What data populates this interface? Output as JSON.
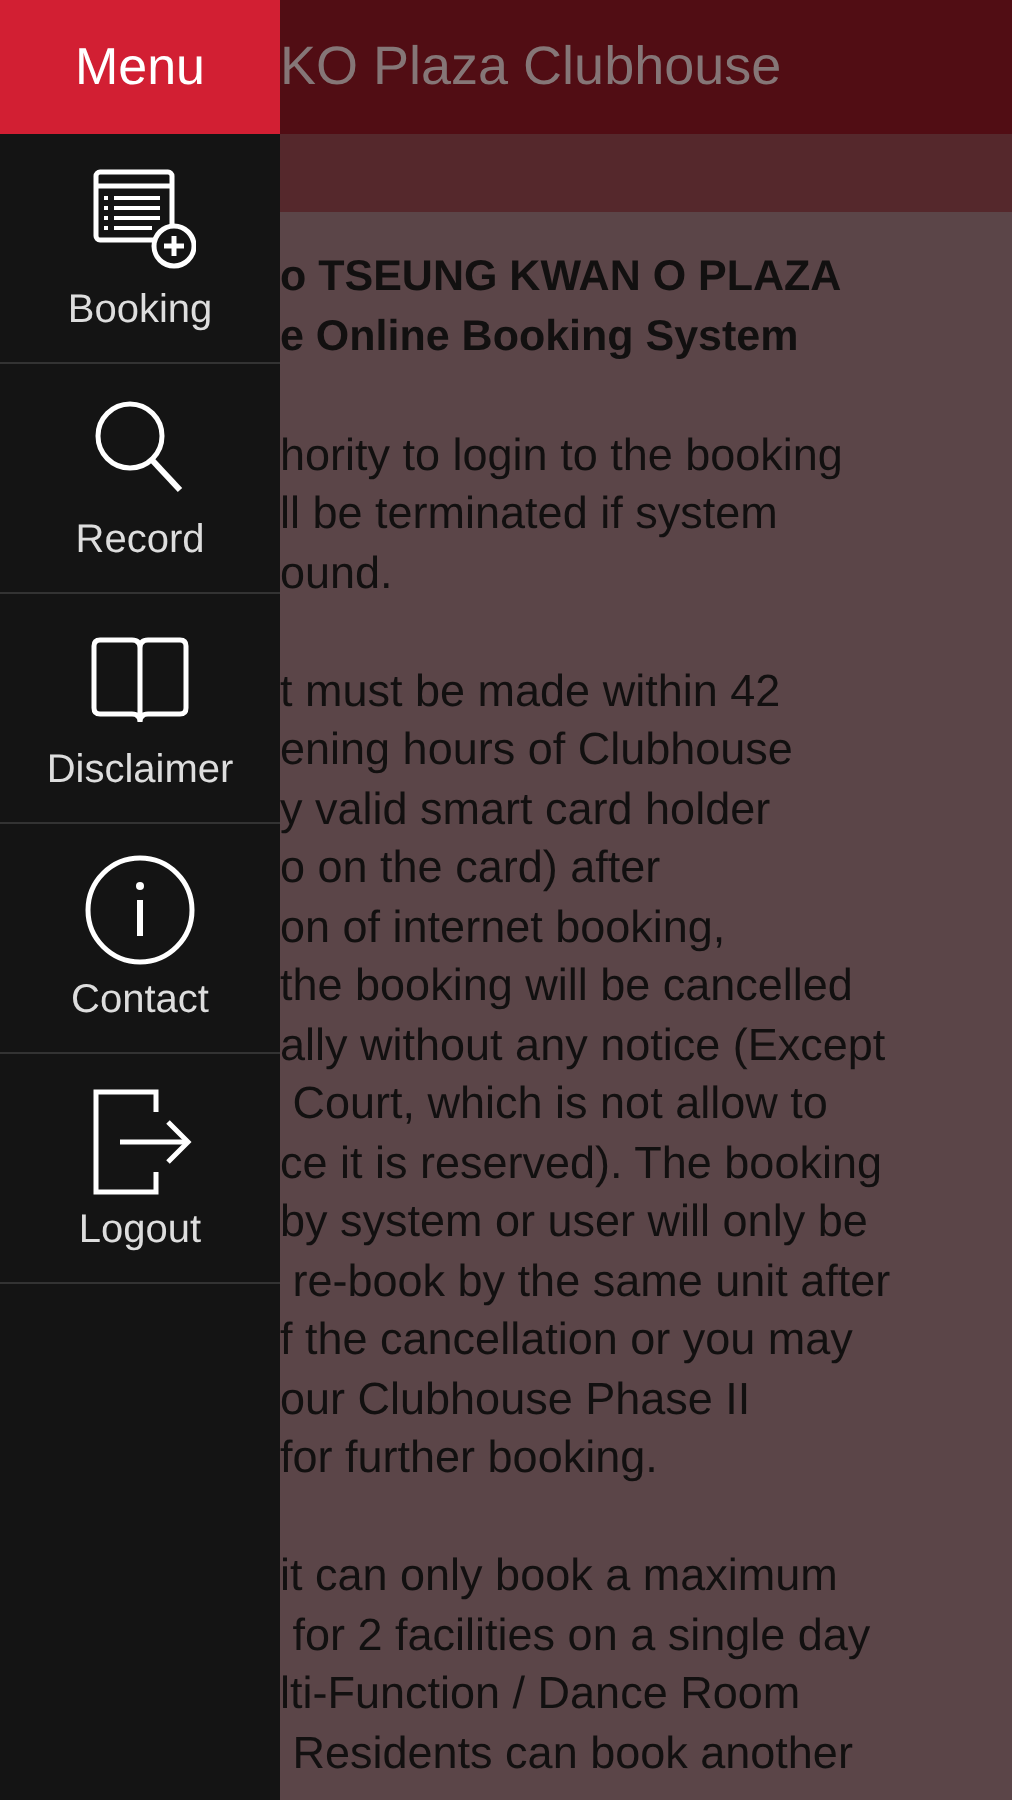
{
  "menu": {
    "title": "Menu",
    "items": [
      {
        "label": "Booking",
        "kind": "booking"
      },
      {
        "label": "Record",
        "kind": "search"
      },
      {
        "label": "Disclaimer",
        "kind": "book"
      },
      {
        "label": "Contact",
        "kind": "info"
      },
      {
        "label": "Logout",
        "kind": "logout"
      }
    ]
  },
  "app_bar": {
    "title": "KO Plaza Clubhouse"
  },
  "content": {
    "heading_lines": [
      "o TSEUNG KWAN O PLAZA",
      "e Online Booking System"
    ],
    "paragraphs": [
      [
        "hority to login to the booking",
        "ll be terminated if system",
        "ound."
      ],
      [
        "t must be made within 42",
        "ening hours of Clubhouse",
        "y valid smart card holder",
        "o on the card) after",
        "on of internet booking,",
        "the booking will be cancelled",
        "ally without any notice (Except",
        " Court, which is not allow to",
        "ce it is reserved). The booking",
        "by system or user will only be",
        " re-book by the same unit after",
        "f the cancellation or you may",
        "our Clubhouse Phase II",
        "for further booking."
      ],
      [
        "it can only book a maximum",
        " for 2 facilities on a single day",
        "lti-Function / Dance Room",
        " Residents can book another"
      ]
    ]
  }
}
